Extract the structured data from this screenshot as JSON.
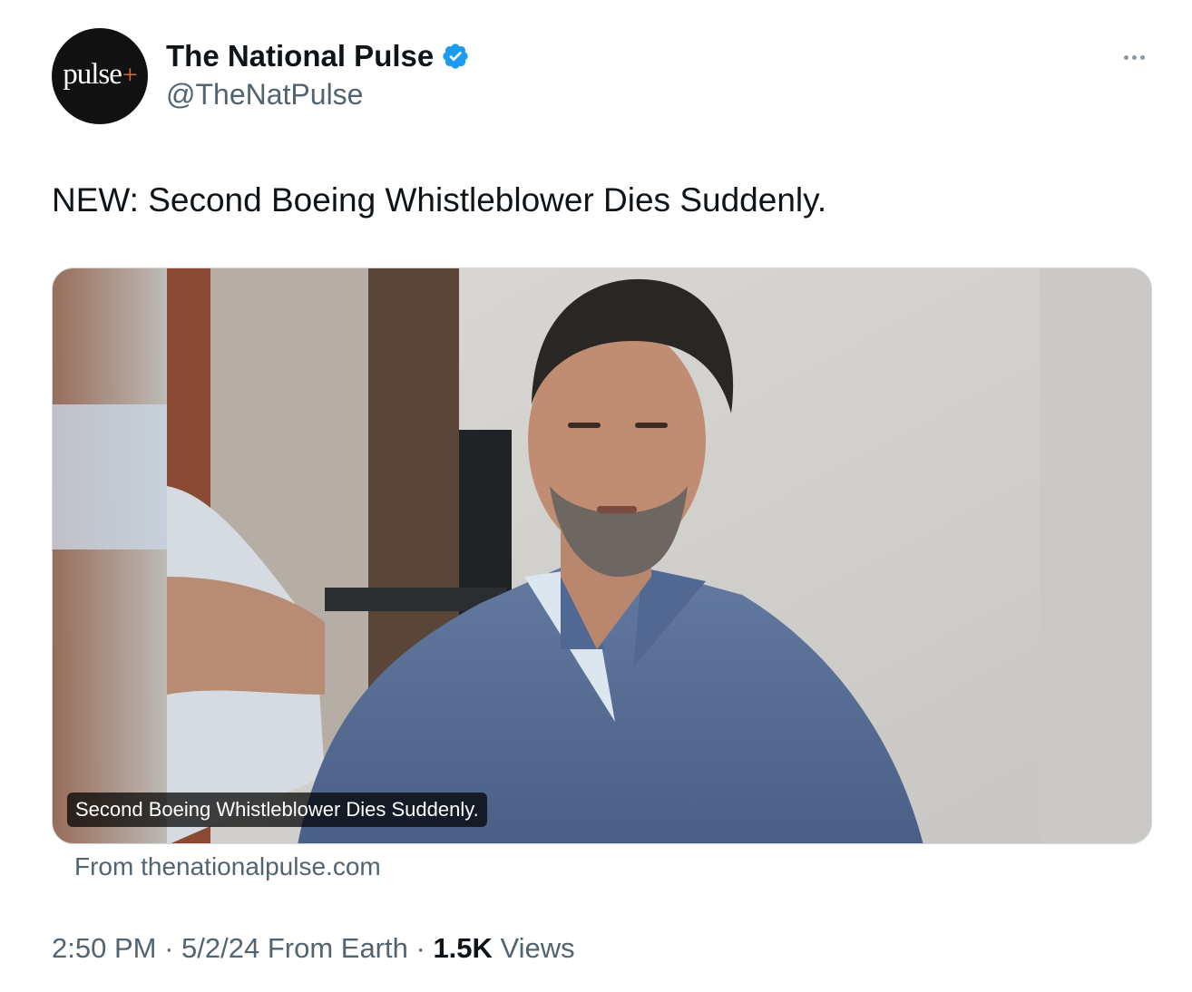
{
  "author": {
    "avatar_text": "pulse",
    "avatar_plus": "+",
    "display_name": "The National Pulse",
    "handle": "@TheNatPulse",
    "verified_color": "#1d9bf0"
  },
  "tweet": {
    "text": "NEW: Second Boeing Whistleblower Dies Suddenly."
  },
  "card": {
    "image_caption": "Second Boeing Whistleblower Dies Suddenly.",
    "source": "From thenationalpulse.com"
  },
  "meta": {
    "time": "2:50 PM",
    "sep1": " · ",
    "date": "5/2/24",
    "location": " From Earth",
    "sep2": " · ",
    "views_count": "1.5K",
    "views_label": " Views"
  },
  "icons": {
    "more": "more-horizontal-icon",
    "verified": "verified-badge-icon"
  }
}
